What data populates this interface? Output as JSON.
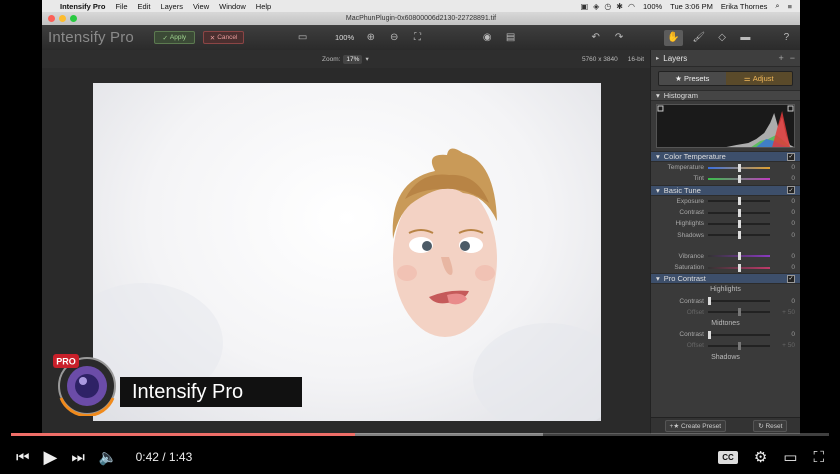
{
  "menubar": {
    "app": "Intensify Pro",
    "items": [
      "File",
      "Edit",
      "Layers",
      "View",
      "Window",
      "Help"
    ],
    "battery": "100%",
    "clock": "Tue 3:06 PM",
    "user": "Erika Thornes"
  },
  "window": {
    "title": "MacPhunPlugin-0x60800006d2130-22728891.tif"
  },
  "toolbar": {
    "logo": "Intensify Pro",
    "apply_label": "Apply",
    "cancel_label": "Cancel",
    "zoom_percent": "100%"
  },
  "infobar": {
    "zoom_label": "Zoom:",
    "zoom_value": "17%",
    "dimensions": "5760 x 3840",
    "bit_depth": "16-bit"
  },
  "badge": {
    "banner_text": "Intensify Pro",
    "pro_label": "PRO"
  },
  "panel": {
    "title": "Layers",
    "presets_label": "Presets",
    "adjust_label": "Adjust",
    "sections": {
      "histogram": "Histogram",
      "color_temperature": "Color Temperature",
      "basic_tune": "Basic Tune",
      "pro_contrast": "Pro Contrast"
    },
    "color_temp_rows": [
      {
        "label": "Temperature",
        "value": "0"
      },
      {
        "label": "Tint",
        "value": "0"
      }
    ],
    "basic_tune_rows": [
      {
        "label": "Exposure",
        "value": "0"
      },
      {
        "label": "Contrast",
        "value": "0"
      },
      {
        "label": "Highlights",
        "value": "0"
      },
      {
        "label": "Shadows",
        "value": "0"
      },
      {
        "label": "Vibrance",
        "value": "0"
      },
      {
        "label": "Saturation",
        "value": "0"
      }
    ],
    "pro_contrast": {
      "highlights_label": "Highlights",
      "midtones_label": "Midtones",
      "shadows_label": "Shadows",
      "highlights_rows": [
        {
          "label": "Contrast",
          "value": "0"
        },
        {
          "label": "Offset",
          "value": "+ 50"
        }
      ],
      "midtones_rows": [
        {
          "label": "Contrast",
          "value": "0"
        },
        {
          "label": "Offset",
          "value": "+ 50"
        }
      ]
    },
    "footer": {
      "create_preset": "Create Preset",
      "reset": "Reset"
    }
  },
  "player": {
    "current_time": "0:42 / 1:43",
    "played_fraction": 0.42,
    "loaded_fraction": 0.65,
    "accent": "#e62117"
  }
}
